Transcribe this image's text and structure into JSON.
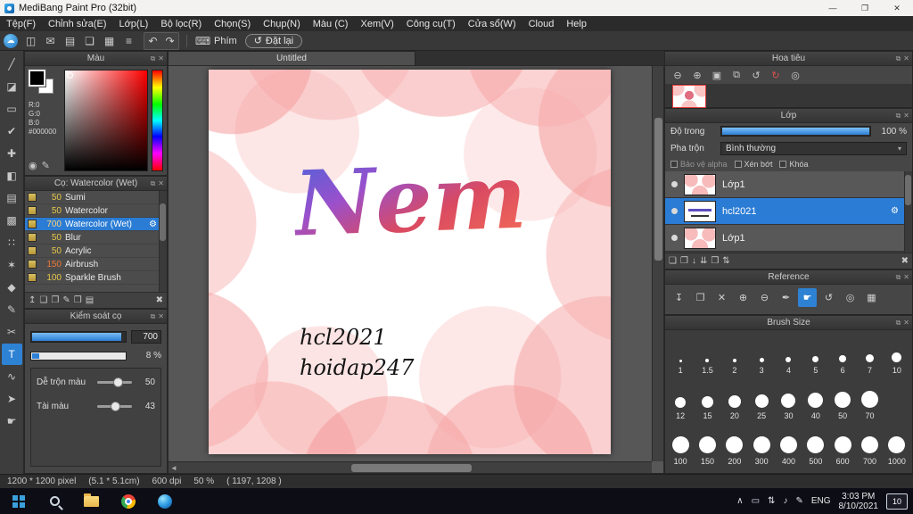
{
  "titlebar": {
    "title": "MediBang Paint Pro (32bit)"
  },
  "menu": {
    "items": [
      "Tệp(F)",
      "Chỉnh sửa(E)",
      "Lớp(L)",
      "Bộ lọc(R)",
      "Chọn(S)",
      "Chụp(N)",
      "Màu (C)",
      "Xem(V)",
      "Công cụ(T)",
      "Cửa sổ(W)",
      "Cloud",
      "Help"
    ]
  },
  "toolbar": {
    "phim": "Phím",
    "dat_lai": "Đặt lại"
  },
  "icons": {
    "window": {
      "minimize": "—",
      "maximize": "❐",
      "close": "✕"
    },
    "toolbar": {
      "cloud": "☁",
      "save": "◫",
      "message": "✉",
      "brush": "▤",
      "doc": "❏",
      "grid": "▦",
      "list": "≡",
      "undo": "↶",
      "redo": "↷",
      "keyboard": "⌨",
      "reset": "↺"
    },
    "tools": [
      {
        "name": "brush",
        "glyph": "╱"
      },
      {
        "name": "eraser",
        "glyph": "◪"
      },
      {
        "name": "select",
        "glyph": "▭"
      },
      {
        "name": "select-pen",
        "glyph": "✔"
      },
      {
        "name": "move",
        "glyph": "✚"
      },
      {
        "name": "bucket",
        "glyph": "◧"
      },
      {
        "name": "gradient",
        "glyph": "▤"
      },
      {
        "name": "pattern",
        "glyph": "▩"
      },
      {
        "name": "dots",
        "glyph": "∷"
      },
      {
        "name": "magic-wand",
        "glyph": "✶"
      },
      {
        "name": "eyedropper",
        "glyph": "◆"
      },
      {
        "name": "pen",
        "glyph": "✎"
      },
      {
        "name": "divide",
        "glyph": "✂"
      },
      {
        "name": "text",
        "glyph": "T"
      },
      {
        "name": "lasso",
        "glyph": "∿"
      },
      {
        "name": "operation",
        "glyph": "➤"
      },
      {
        "name": "hand",
        "glyph": "☛"
      }
    ],
    "navigator": [
      "⊖",
      "⊕",
      "▣",
      "⧉",
      "↺",
      "↻",
      "◎"
    ],
    "reference": [
      "↧",
      "❒",
      "✕",
      "⊕",
      "⊖",
      "✒",
      "☛",
      "↺",
      "◎",
      "▦"
    ],
    "layer_actions": [
      "❏",
      "❐",
      "↓",
      "⇊",
      "❒",
      "⇅",
      "✖"
    ],
    "brush_actions": [
      "↥",
      "❏",
      "❐",
      "✎",
      "❒",
      "▤",
      "✖"
    ],
    "color_actions": [
      "◉",
      "✎"
    ],
    "gear": "⚙",
    "caret": "▾",
    "tray": [
      "∧",
      "▭",
      "⇅",
      "♪",
      "✎"
    ]
  },
  "panels": {
    "color": {
      "title": "Màu",
      "r": "R:0",
      "g": "G:0",
      "b": "B:0",
      "hex": "#000000"
    },
    "brushes": {
      "title": "Cọ: Watercolor (Wet)",
      "items": [
        {
          "size": "50",
          "name": "Sumi",
          "size_color": "#e8c84a"
        },
        {
          "size": "50",
          "name": "Watercolor",
          "size_color": "#e8c84a"
        },
        {
          "size": "700",
          "name": "Watercolor (Wet)",
          "size_color": "#ffd27a"
        },
        {
          "size": "50",
          "name": "Blur",
          "size_color": "#e8c84a"
        },
        {
          "size": "50",
          "name": "Acrylic",
          "size_color": "#e8c84a"
        },
        {
          "size": "150",
          "name": "Airbrush",
          "size_color": "#f07838"
        },
        {
          "size": "100",
          "name": "Sparkle Brush",
          "size_color": "#e8c84a"
        }
      ]
    },
    "brush_control": {
      "title": "Kiểm soát cọ",
      "size_value": "700",
      "opacity_value": "8 %",
      "mix_label": "Dễ trộn màu",
      "mix_value": "50",
      "load_label": "Tài màu",
      "load_value": "43"
    },
    "navigator": {
      "title": "Hoa tiêu"
    },
    "layers": {
      "title": "Lớp",
      "opacity_label": "Độ trong",
      "opacity_value": "100 %",
      "blend_label": "Pha trộn",
      "blend_value": "Bình thường",
      "check_alpha": "Bảo vệ alpha",
      "check_clip": "Xén bớt",
      "check_lock": "Khóa",
      "items": [
        {
          "name": "Lớp1"
        },
        {
          "name": "hcl2021"
        },
        {
          "name": "Lớp1"
        }
      ]
    },
    "reference": {
      "title": "Reference"
    },
    "brush_size": {
      "title": "Brush Size",
      "row1": [
        "1",
        "1.5",
        "2",
        "3",
        "4",
        "5",
        "6",
        "7",
        "10"
      ],
      "row2": [
        "12",
        "15",
        "20",
        "25",
        "30",
        "40",
        "50",
        "70"
      ],
      "row3": [
        "100",
        "150",
        "200",
        "300",
        "400",
        "500",
        "600",
        "700",
        "1000"
      ]
    }
  },
  "canvas": {
    "tab": "Untitled",
    "artwork_word": "Nem",
    "note_line1": "hcl2021",
    "note_line2": "hoidap247"
  },
  "statusbar": {
    "size": "1200 * 1200 pixel",
    "cm": "(5.1 * 5.1cm)",
    "dpi": "600 dpi",
    "zoom": "50 %",
    "coords": "( 1197, 1208 )"
  },
  "taskbar": {
    "lang": "ENG",
    "time": "3:03 PM",
    "date": "8/10/2021",
    "badge": "10"
  },
  "colors": {
    "accent_blue": "#2e82d4",
    "selected_row": "#2b7cd4",
    "canvas_pink": "#f6b8b8"
  }
}
